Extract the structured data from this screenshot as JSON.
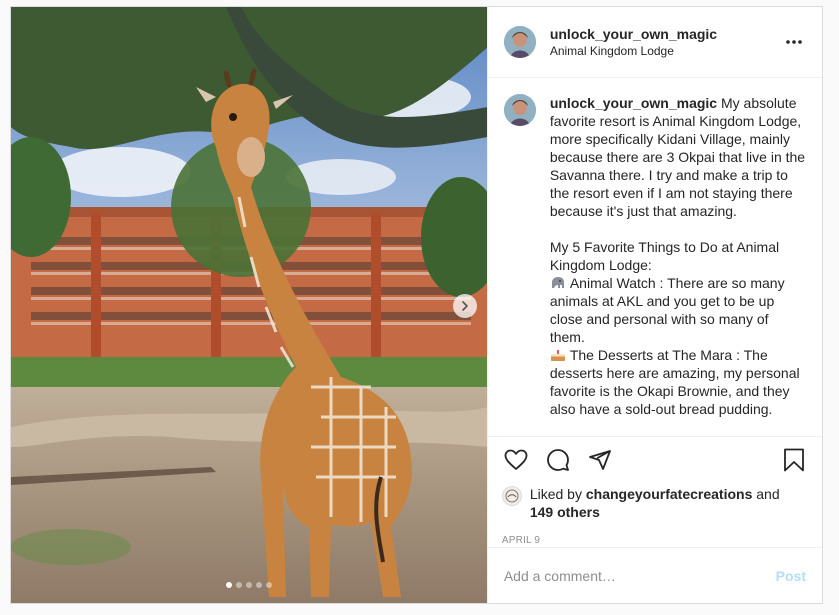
{
  "post": {
    "username": "unlock_your_own_magic",
    "location": "Animal Kingdom Lodge",
    "caption": {
      "p1": "My absolute favorite resort is Animal Kingdom Lodge, more specifically Kidani Village, mainly because there are 3 Okpai that live in the Savanna there. I try and make a trip to the resort even if I am not staying there because it's just that amazing.",
      "p2": "My 5 Favorite Things to Do at Animal Kingdom Lodge:",
      "item1": "Animal Watch : There are so many animals at AKL and you get to be up close and personal with so many of them.",
      "item2": "The Desserts at The Mara : The desserts here are amazing, my personal favorite is the Okapi Brownie, and they also have a sold-out bread pudding."
    },
    "likes": {
      "prefix": "Liked by",
      "user": "changeyourfatecreations",
      "and": "and",
      "others": "149 others"
    },
    "date": "APRIL 9",
    "comment_placeholder": "Add a comment…",
    "post_label": "Post",
    "carousel": {
      "slides": 5,
      "active": 0
    }
  },
  "colors": {
    "link_blue_disabled": "#b2dffc",
    "muted_text": "#8e8e8e",
    "border": "#dbdbdb"
  },
  "icons": [
    "more-options-icon",
    "heart-icon",
    "comment-icon",
    "share-icon",
    "bookmark-icon",
    "next-arrow-icon",
    "elephant-emoji-icon",
    "cake-emoji-icon"
  ]
}
